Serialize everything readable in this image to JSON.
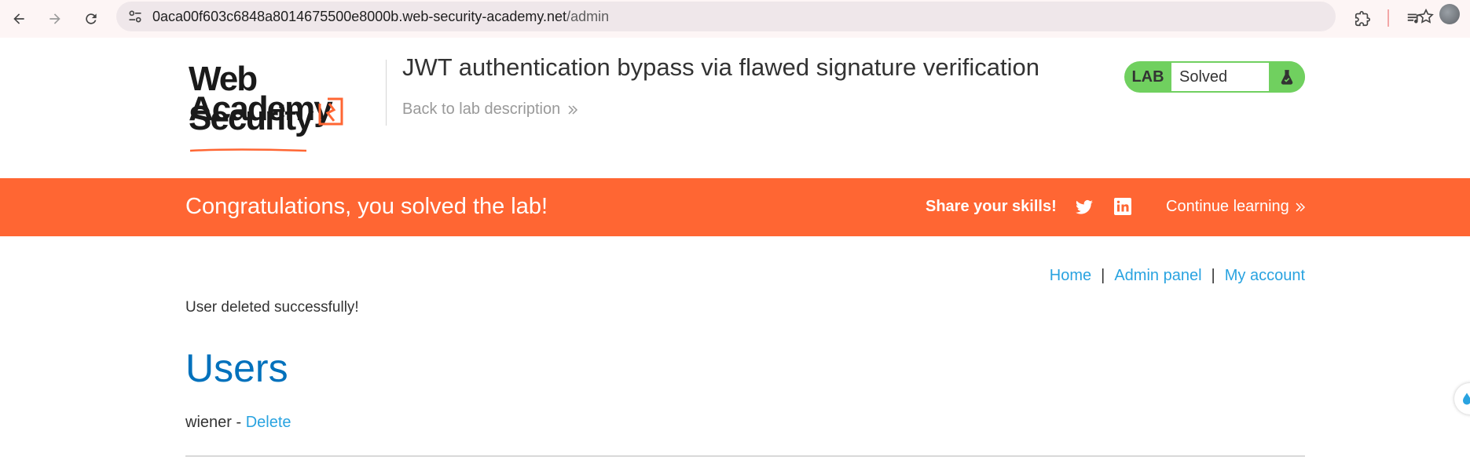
{
  "browser": {
    "url_host": "0aca00f603c6848a8014675500e8000b.web-security-academy.net",
    "url_path": "/admin"
  },
  "header": {
    "logo": {
      "line1": "Web Security",
      "line2": "Academy"
    },
    "lab_title": "JWT authentication bypass via flawed signature verification",
    "back_link": "Back to lab description",
    "lab_status": {
      "label": "LAB",
      "state": "Solved"
    }
  },
  "banner": {
    "message": "Congratulations, you solved the lab!",
    "share_label": "Share your skills!",
    "continue_label": "Continue learning"
  },
  "nav": {
    "home": "Home",
    "admin_panel": "Admin panel",
    "my_account": "My account",
    "separator": "|"
  },
  "content": {
    "status_message": "User deleted successfully!",
    "heading": "Users",
    "users": [
      {
        "name": "wiener",
        "separator": " - ",
        "action": "Delete"
      }
    ]
  },
  "colors": {
    "banner_bg": "#ff6633",
    "link": "#29a3e0",
    "heading": "#0071bc",
    "lab_green": "#70d05f"
  }
}
